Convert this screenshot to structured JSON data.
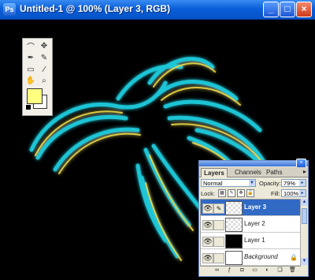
{
  "window": {
    "title": "Untitled-1 @ 100% (Layer 3, RGB)",
    "app_icon": "Ps",
    "minimize_label": "_",
    "maximize_label": "□",
    "close_label": "×"
  },
  "toolbox": {
    "tools": [
      "lasso-icon",
      "move-icon",
      "pen-icon",
      "brush-icon",
      "eraser-icon",
      "eyedropper-icon",
      "hand-icon",
      "zoom-icon"
    ],
    "foreground_color": "#ffff80",
    "background_color": "#ffffff"
  },
  "layers_panel": {
    "tabs": [
      "Layers",
      "Channels",
      "Paths"
    ],
    "active_tab": "Layers",
    "blend_mode": "Normal",
    "opacity_label": "Opacity:",
    "opacity_value": "79%",
    "lock_label": "Lock:",
    "fill_label": "Fill:",
    "fill_value": "100%",
    "layers": [
      {
        "name": "Layer 3",
        "selected": true
      },
      {
        "name": "Layer 2",
        "selected": false
      },
      {
        "name": "Layer 1",
        "selected": false
      },
      {
        "name": "Background",
        "selected": false
      }
    ]
  }
}
